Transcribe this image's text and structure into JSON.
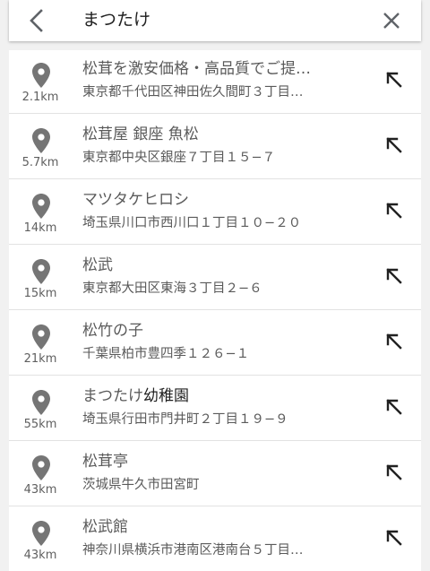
{
  "search": {
    "query": "まつたけ"
  },
  "icons": {
    "back": "chevron-left-icon",
    "clear": "close-icon",
    "location": "location-pin-icon",
    "fill": "arrow-up-left-icon"
  },
  "results": [
    {
      "title_match": "松茸を激安価格・高品質でご提…",
      "title_rest": "",
      "address": "東京都千代田区神田佐久間町３丁目…",
      "distance": "2.1km"
    },
    {
      "title_match": "松茸屋 銀座 魚松",
      "title_rest": "",
      "address": "東京都中央区銀座７丁目１５−７",
      "distance": "5.7km"
    },
    {
      "title_match": "マツタケヒロシ",
      "title_rest": "",
      "address": "埼玉県川口市西川口１丁目１０−２０",
      "distance": "14km"
    },
    {
      "title_match": "松武",
      "title_rest": "",
      "address": "東京都大田区東海３丁目２−６",
      "distance": "15km"
    },
    {
      "title_match": "松竹の子",
      "title_rest": "",
      "address": "千葉県柏市豊四季１２６−１",
      "distance": "21km"
    },
    {
      "title_match": "まつたけ",
      "title_rest": "幼稚園",
      "address": "埼玉県行田市門井町２丁目１９−９",
      "distance": "55km"
    },
    {
      "title_match": "松茸亭",
      "title_rest": "",
      "address": "茨城県牛久市田宮町",
      "distance": "43km"
    },
    {
      "title_match": "松武館",
      "title_rest": "",
      "address": "神奈川県横浜市港南区港南台５丁目…",
      "distance": "43km"
    }
  ]
}
